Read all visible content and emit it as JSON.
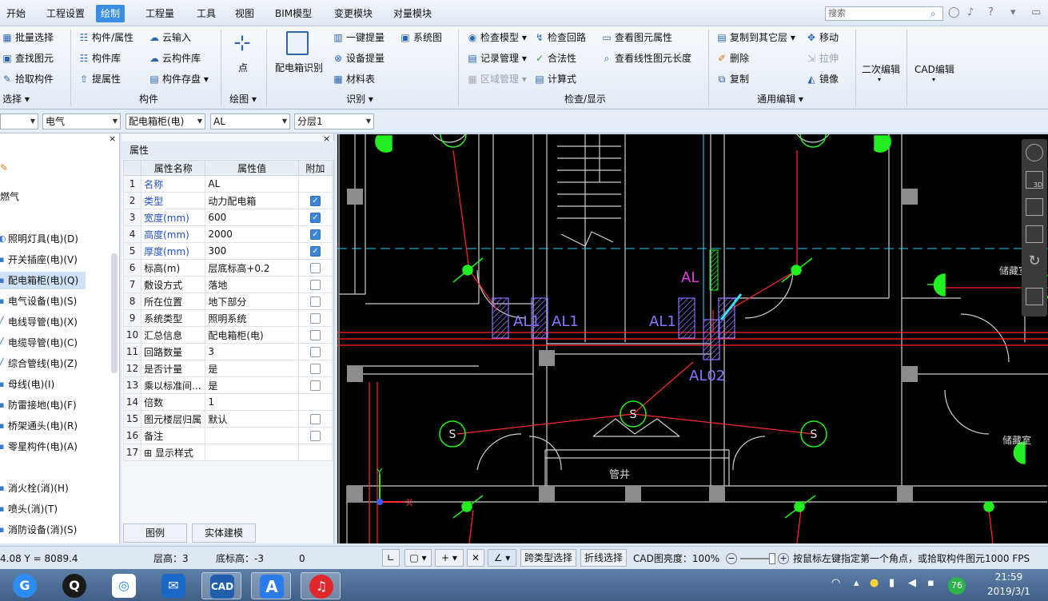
{
  "menu": {
    "items": [
      "开始",
      "工程设置",
      "绘制",
      "工程量",
      "工具",
      "视图",
      "BIM模型",
      "变更模块",
      "对量模块"
    ],
    "active_index": 2,
    "search_placeholder": "搜索"
  },
  "ribbon": {
    "select_group": {
      "items": [
        "批量选择",
        "查找图元",
        "拾取构件"
      ],
      "label": "选择"
    },
    "component_group": {
      "items": [
        "构件/属性",
        "构件库",
        "提属性",
        "云输入",
        "云构件库",
        "构件存盘"
      ],
      "label": "构件"
    },
    "draw_group": {
      "point_label": "点",
      "label": "绘图"
    },
    "identify_group": {
      "big_button": "配电箱识别",
      "items": [
        "一键提量",
        "设备提量",
        "材料表",
        "系统图"
      ],
      "label": "识别"
    },
    "check_group": {
      "items": [
        "检查模型",
        "记录管理",
        "区域管理",
        "检查回路",
        "合法性",
        "计算式",
        "查看图元属性",
        "查看线性图元长度"
      ],
      "label": "检查/显示"
    },
    "edit_group": {
      "items": [
        "复制到其它层",
        "删除",
        "复制",
        "移动",
        "拉伸",
        "镜像"
      ],
      "label": "通用编辑"
    },
    "secondary_edit": "二次编辑",
    "cad_edit": "CAD编辑"
  },
  "selectors": [
    "",
    "电气",
    "配电箱柜(电)",
    "AL",
    "分层1"
  ],
  "tree": {
    "close": "×",
    "items": [
      "燃气",
      "照明灯具(电)(D)",
      "开关插座(电)(V)",
      "配电箱柜(电)(Q)",
      "电气设备(电)(S)",
      "电线导管(电)(X)",
      "电缆导管(电)(C)",
      "综合管线(电)(Z)",
      "母线(电)(I)",
      "防雷接地(电)(F)",
      "桥架通头(电)(R)",
      "零星构件(电)(A)",
      "消火栓(消)(H)",
      "喷头(消)(T)",
      "消防设备(消)(S)"
    ],
    "selected": "配电箱柜(电)(Q)"
  },
  "properties": {
    "title": "属性",
    "close": "×",
    "headers": [
      "属性名称",
      "属性值",
      "附加"
    ],
    "rows": [
      {
        "idx": "1",
        "name": "名称",
        "value": "AL",
        "blue": true,
        "check": null
      },
      {
        "idx": "2",
        "name": "类型",
        "value": "动力配电箱",
        "blue": true,
        "check": true
      },
      {
        "idx": "3",
        "name": "宽度(mm)",
        "value": "600",
        "blue": true,
        "check": true
      },
      {
        "idx": "4",
        "name": "高度(mm)",
        "value": "2000",
        "blue": true,
        "check": true
      },
      {
        "idx": "5",
        "name": "厚度(mm)",
        "value": "300",
        "blue": true,
        "check": true
      },
      {
        "idx": "6",
        "name": "标高(m)",
        "value": "层底标高+0.2",
        "blue": false,
        "check": false
      },
      {
        "idx": "7",
        "name": "敷设方式",
        "value": "落地",
        "blue": false,
        "check": false
      },
      {
        "idx": "8",
        "name": "所在位置",
        "value": "地下部分",
        "blue": false,
        "check": false
      },
      {
        "idx": "9",
        "name": "系统类型",
        "value": "照明系统",
        "blue": false,
        "check": false
      },
      {
        "idx": "10",
        "name": "汇总信息",
        "value": "配电箱柜(电)",
        "blue": false,
        "check": false
      },
      {
        "idx": "11",
        "name": "回路数量",
        "value": "3",
        "blue": false,
        "check": false
      },
      {
        "idx": "12",
        "name": "是否计量",
        "value": "是",
        "blue": false,
        "check": false
      },
      {
        "idx": "13",
        "name": "乘以标准间...",
        "value": "是",
        "blue": false,
        "check": false
      },
      {
        "idx": "14",
        "name": "倍数",
        "value": "1",
        "blue": false,
        "check": null
      },
      {
        "idx": "15",
        "name": "图元楼层归属",
        "value": "默认",
        "blue": false,
        "check": false
      },
      {
        "idx": "16",
        "name": "备注",
        "value": "",
        "blue": false,
        "check": false
      },
      {
        "idx": "17",
        "name": "⊞ 显示样式",
        "value": "",
        "blue": false,
        "check": null
      }
    ],
    "tabs": [
      "图例",
      "实体建模"
    ]
  },
  "canvas": {
    "labels": [
      "AL1",
      "AL1",
      "AL1",
      "AL",
      "AL02",
      "管井",
      "储藏室",
      "储藏室"
    ],
    "socket_label": "S",
    "axis_x": "X",
    "axis_y": "Y",
    "colors": {
      "wall": "#d0d0d0",
      "wire": "#ff2a2a",
      "device": "#22ee22",
      "box": "#8a74ff",
      "magenta": "#e040e0",
      "cyan": "#33e0ff"
    }
  },
  "status": {
    "coords": "4.08 Y = 8089.4",
    "floor_height": "层高：3",
    "base_elevation": "底标高：-3",
    "zero": "0",
    "cross_type_select": "跨类型选择",
    "polyline_select": "折线选择",
    "cad_brightness": "CAD图亮度：100%",
    "brightness": 1.0,
    "hint": "按鼠标左键指定第一个角点，或拾取构件图元1000 FPS"
  },
  "taskbar": {
    "apps": [
      "start-orb",
      "qq",
      "baidu-netdisk",
      "mail-app",
      "cad-app",
      "text-app",
      "netease-music"
    ],
    "cad_label": "CAD",
    "text_label": "A",
    "time": "21:59",
    "date": "2019/3/1",
    "badge": "76"
  }
}
